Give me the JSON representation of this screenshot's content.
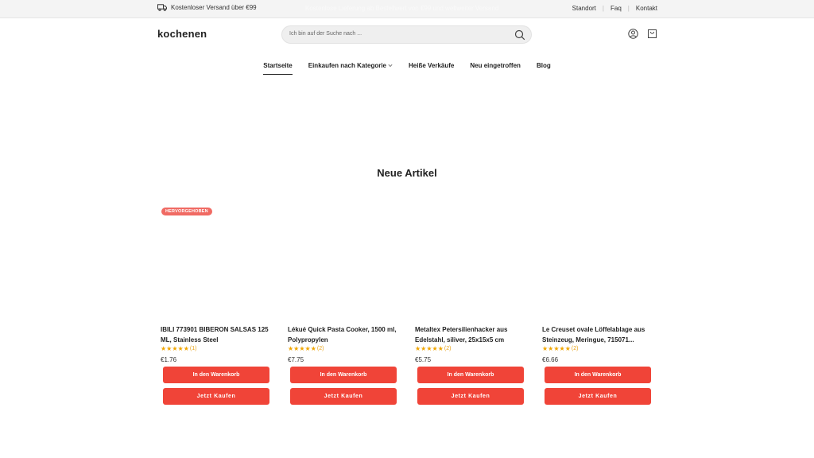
{
  "topbar": {
    "shipping_text": "Kostenloser Versand über €99",
    "shipping_icon": "truck-icon",
    "promo_text": "Kostenlose Lieferung ab Bestellwert von €99 und weltweiter Versand",
    "links": [
      "Standort",
      "Faq",
      "Kontakt"
    ]
  },
  "header": {
    "logo": "kochenen",
    "search_placeholder": "Ich bin auf der Suche nach ...",
    "icons": [
      "search-icon",
      "user-icon",
      "shopping-bag-icon"
    ]
  },
  "nav": {
    "items": [
      {
        "label": "Startseite",
        "active": true
      },
      {
        "label": "Einkaufen nach Kategorie",
        "dropdown": true
      },
      {
        "label": "Heiße Verkäufe"
      },
      {
        "label": "Neu eingetroffen"
      },
      {
        "label": "Blog"
      }
    ]
  },
  "section": {
    "title": "Neue Artikel"
  },
  "products": [
    {
      "badge": "HERVORGEHOBEN",
      "name": "IBILI 773901 BIBERON SALSAS 125 ML, Stainless Steel",
      "rating": 5,
      "review_count": "(1)",
      "price": "€1.76",
      "cart_label": "In den Warenkorb",
      "buy_label": "Jetzt Kaufen"
    },
    {
      "name": "Lékué Quick Pasta Cooker, 1500 ml, Polypropylen",
      "rating": 5,
      "review_count": "(2)",
      "price": "€7.75",
      "cart_label": "In den Warenkorb",
      "buy_label": "Jetzt Kaufen"
    },
    {
      "name": "Metaltex Petersilienhacker aus Edelstahl, siliver, 25x15x5 cm",
      "rating": 5,
      "review_count": "(2)",
      "price": "€5.75",
      "cart_label": "In den Warenkorb",
      "buy_label": "Jetzt Kaufen"
    },
    {
      "name": "Le Creuset ovale Löffelablage aus Steinzeug, Meringue, 715071...",
      "rating": 5,
      "review_count": "(2)",
      "price": "€6.66",
      "cart_label": "In den Warenkorb",
      "buy_label": "Jetzt Kaufen"
    }
  ],
  "colors": {
    "accent": "#f04438",
    "badge": "#f06a63",
    "star": "#f0a500",
    "topbar_bg": "#f4f4f4"
  }
}
